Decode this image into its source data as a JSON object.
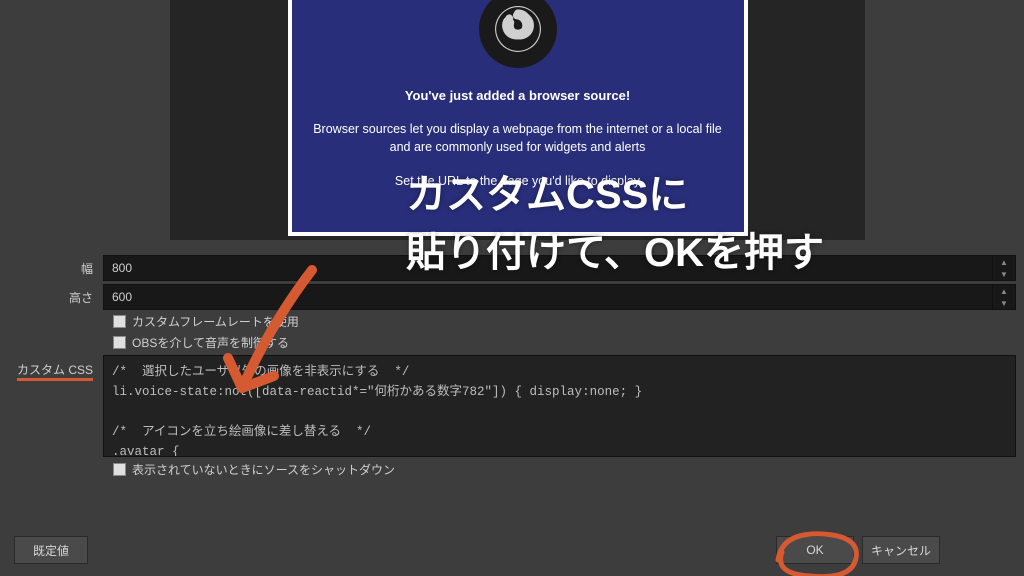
{
  "preview": {
    "line1": "You've just added a browser source!",
    "line2": "Browser sources let you display a webpage from the internet or a local file and are commonly used for widgets and alerts",
    "line3": "Set the URL to the page you'd like to display"
  },
  "form": {
    "width_label": "幅",
    "width_value": "800",
    "height_label": "高さ",
    "height_value": "600",
    "chk_custom_fps": "カスタムフレームレートを使用",
    "chk_obs_audio": "OBSを介して音声を制御する",
    "custom_css_label": "カスタム CSS",
    "css_text": "/*  選択したユーザ以外の画像を非表示にする  */\nli.voice-state:not([data-reactid*=\"何桁かある数字782\"]) { display:none; }\n\n/*  アイコンを立ち絵画像に差し替える  */\n.avatar {",
    "chk_shutdown": "表示されていないときにソースをシャットダウン"
  },
  "buttons": {
    "default": "既定値",
    "ok": "OK",
    "cancel": "キャンセル"
  },
  "annotation": {
    "line1": "カスタムCSSに",
    "line2": "貼り付けて、OKを押す"
  }
}
